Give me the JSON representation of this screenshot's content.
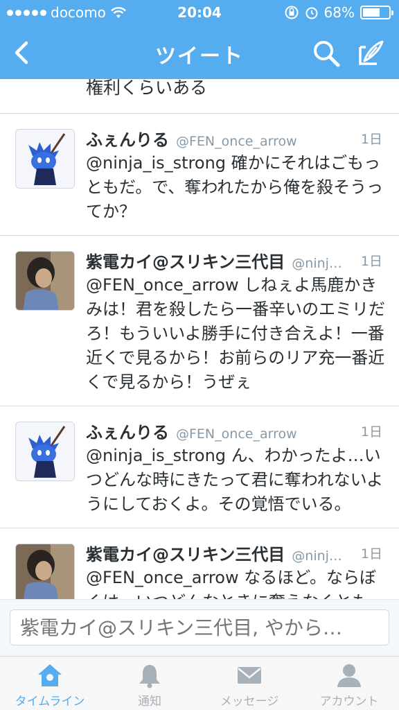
{
  "status_bar": {
    "carrier": "docomo",
    "time": "20:04",
    "battery_percent": "68%",
    "battery_level": 0.68
  },
  "nav": {
    "title": "ツイート"
  },
  "feed": {
    "partial_text": "権利くらいある",
    "tweets": [
      {
        "name": "ふぇんりる",
        "handle": "@FEN_once_arrow",
        "time": "1日",
        "text": "@ninja_is_strong 確かにそれはごもっともだ。で、奪われたから俺を殺そうってか？",
        "avatar": "ninja-avatar"
      },
      {
        "name": "紫電カイ@スリキン三代目",
        "handle": "@ninj…",
        "time": "1日",
        "text": "@FEN_once_arrow しねぇよ馬鹿かきみは！君を殺したら一番辛いのエミリだろ！もういいよ勝手に付き合えよ！一番近くで見るから！お前らのリア充一番近くで見るから！うぜぇ",
        "avatar": "photo-avatar"
      },
      {
        "name": "ふぇんりる",
        "handle": "@FEN_once_arrow",
        "time": "1日",
        "text": "@ninja_is_strong ん、わかったよ…いつどんな時にきたって君に奪われないようにしておくよ。その覚悟でいる。",
        "avatar": "ninja-avatar"
      },
      {
        "name": "紫電カイ@スリキン三代目",
        "handle": "@ninj…",
        "time": "1日",
        "text": "@FEN_once_arrow なるほど。ならぼくは。いつどんなときに奪えなくとも。最後の最後で奪えるようにする。",
        "avatar": "photo-avatar"
      }
    ]
  },
  "reply": {
    "placeholder": "紫電カイ@スリキン三代目, やから…"
  },
  "tabs": [
    {
      "label": "タイムライン",
      "icon": "home-icon",
      "active": true
    },
    {
      "label": "通知",
      "icon": "bell-icon",
      "active": false
    },
    {
      "label": "メッセージ",
      "icon": "envelope-icon",
      "active": false
    },
    {
      "label": "アカウント",
      "icon": "person-icon",
      "active": false
    }
  ],
  "colors": {
    "brand_blue": "#55acee",
    "inactive_tab": "#a9b1b8",
    "meta_gray": "#8899a6"
  }
}
